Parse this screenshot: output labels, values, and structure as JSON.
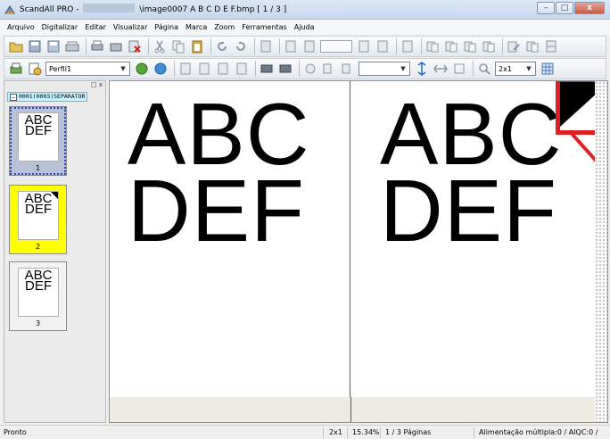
{
  "window": {
    "title_prefix": "ScandAll PRO -",
    "title_suffix": "\\image0007 A B C D E F.bmp  [ 1 / 3 ]",
    "buttons": [
      "–",
      "□",
      "x"
    ]
  },
  "menu": [
    {
      "label": "Arquivo"
    },
    {
      "label": "Digitalizar"
    },
    {
      "label": "Editar"
    },
    {
      "label": "Visualizar"
    },
    {
      "label": "Página"
    },
    {
      "label": "Marca"
    },
    {
      "label": "Zoom"
    },
    {
      "label": "Ferramentas"
    },
    {
      "label": "Ajuda"
    }
  ],
  "toolbar2": {
    "profile_value": "Perfil1",
    "zoom_value": "2x1"
  },
  "left_panel": {
    "header_controls": "□ x",
    "separator_label": "0001(0003)SEPARATOR",
    "separator_toggle": "–",
    "thumbnails": [
      {
        "text": "ABC\nDEF",
        "number": "1"
      },
      {
        "text": "ABC\nDEF",
        "number": "2"
      },
      {
        "text": "ABC\nDEF",
        "number": "3"
      }
    ]
  },
  "document": {
    "page1_line1": "ABC",
    "page1_line2": "DEF",
    "page2_line1": "ABC",
    "page2_line2": "DEF"
  },
  "status": {
    "ready": "Pronto",
    "view": "2x1",
    "zoom": "15.34%",
    "pages": "1 / 3 Páginas",
    "feed": "Alimentação múltipla:0 / AIQC:0 /"
  },
  "colors": {
    "selected_thumb": "#b8c2d6",
    "marked_thumb": "#ffff00",
    "zoom_frame": "#e02020",
    "separator_tag": "#c7f2ff"
  }
}
